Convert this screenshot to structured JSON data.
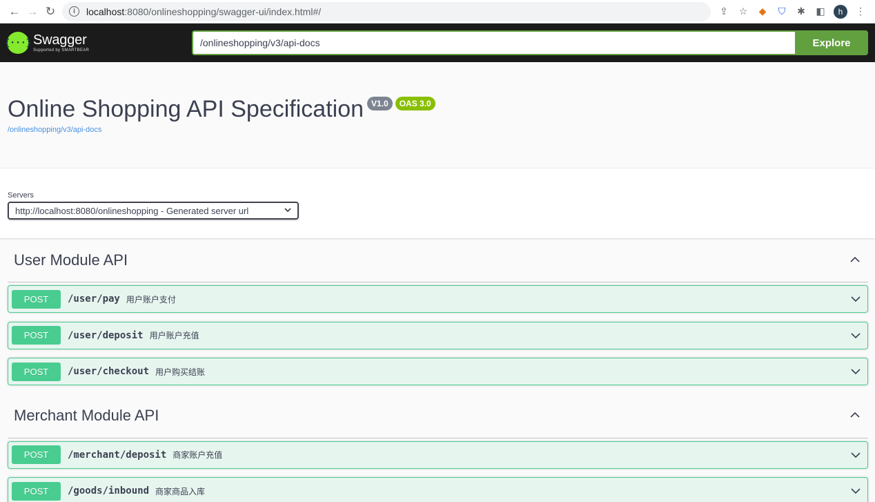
{
  "browser": {
    "url_host": "localhost",
    "url_rest": ":8080/onlineshopping/swagger-ui/index.html#/",
    "avatar_letter": "h"
  },
  "topbar": {
    "logo_title": "Swagger",
    "logo_sub": "Supported by SMARTBEAR",
    "logo_mark": "{···}",
    "spec_url": "/onlineshopping/v3/api-docs",
    "explore_label": "Explore"
  },
  "info": {
    "title": "Online Shopping API Specification",
    "version_badge": "V1.0",
    "oas_badge": "OAS 3.0",
    "spec_link": "/onlineshopping/v3/api-docs"
  },
  "servers": {
    "label": "Servers",
    "selected": "http://localhost:8080/onlineshopping - Generated server url"
  },
  "tags": [
    {
      "name": "User Module API",
      "operations": [
        {
          "method": "POST",
          "path": "/user/pay",
          "summary": "用户账户支付"
        },
        {
          "method": "POST",
          "path": "/user/deposit",
          "summary": "用户账户充值"
        },
        {
          "method": "POST",
          "path": "/user/checkout",
          "summary": "用户购买结账"
        }
      ]
    },
    {
      "name": "Merchant Module API",
      "operations": [
        {
          "method": "POST",
          "path": "/merchant/deposit",
          "summary": "商家账户充值"
        },
        {
          "method": "POST",
          "path": "/goods/inbound",
          "summary": "商家商品入库"
        }
      ]
    }
  ],
  "colors": {
    "post": "#49cc90",
    "topbar_bg": "#1b1b1b",
    "explore": "#62a03f",
    "oas_badge": "#89bf04",
    "version_badge": "#7d8492",
    "link": "#4990e2"
  },
  "icons": {
    "back": "arrow-left-icon",
    "forward": "arrow-right-icon",
    "reload": "reload-icon",
    "info": "info-icon",
    "share": "share-icon",
    "star": "star-icon",
    "metamask": "fox-icon",
    "bitwarden": "shield-icon",
    "extensions": "puzzle-icon",
    "sidepanel": "side-panel-icon",
    "menu": "kebab-menu-icon",
    "tag_expanded": "chevron-up-icon",
    "op_collapsed": "chevron-down-icon"
  }
}
